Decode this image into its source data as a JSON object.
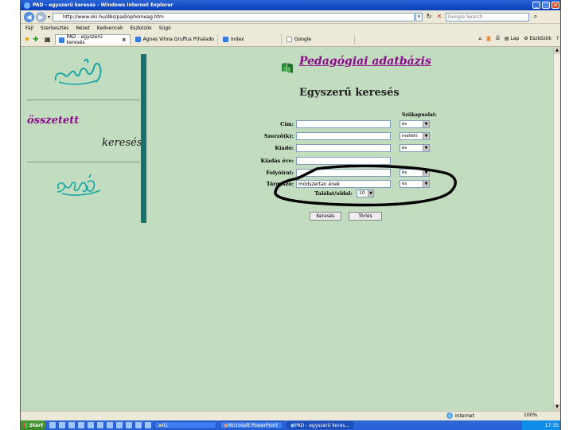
{
  "window": {
    "title": "PAD - egyszerű keresés - Windows Internet Explorer",
    "controls": [
      "_",
      "□",
      "×"
    ]
  },
  "address": {
    "url": "http://www.oki.hu/dbs/pad/ophomeag.htm",
    "search_placeholder": "Google Search"
  },
  "menu": [
    "Fájl",
    "Szerkesztés",
    "Nézet",
    "Kedvencek",
    "Eszközök",
    "Súgó"
  ],
  "tabs": [
    {
      "label": "PAD - egyszerű keresés",
      "active": true
    },
    {
      "label": "Agnes Vilma Gruffus P(halado",
      "active": false
    },
    {
      "label": "Index",
      "active": false
    },
    {
      "label": "Google",
      "active": false
    }
  ],
  "tab_tools": {
    "page": "Lap",
    "tools": "Eszközök"
  },
  "sidebar": {
    "word1": "összetett",
    "word2": "keresés"
  },
  "page": {
    "brand": "Pedagógiai adatbázis",
    "heading": "Egyszerű keresés",
    "operator_header": "Szűkapuolat:",
    "fields": [
      {
        "label": "Cím:",
        "value": "",
        "op": "és"
      },
      {
        "label": "Szerző(k):",
        "value": "",
        "op": "mellett"
      },
      {
        "label": "Kiadó:",
        "value": "",
        "op": "és"
      },
      {
        "label": "Kiadás éve:",
        "value": "",
        "op": ""
      },
      {
        "label": "Folyóirat:",
        "value": "",
        "op": "és"
      },
      {
        "label": "Tárgyszó:",
        "value": "módszertan ének",
        "op": "és"
      }
    ],
    "hits_label": "Találat/oldal:",
    "hits_value": "10",
    "search_button": "Keresés",
    "clear_button": "Törlés"
  },
  "status": {
    "zone": "Internet",
    "zoom": "100%"
  },
  "taskbar": {
    "start": "Start",
    "items": [
      {
        "label": "01",
        "active": false
      },
      {
        "label": "Microsoft PowerPoint - [...",
        "active": false
      },
      {
        "label": "PAD - egyszerű keres...",
        "active": true
      }
    ],
    "clock": "17:35"
  }
}
